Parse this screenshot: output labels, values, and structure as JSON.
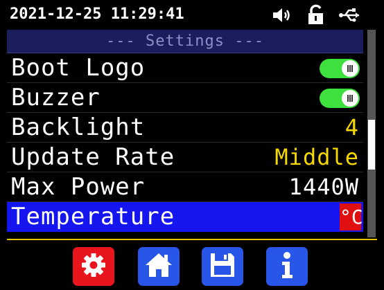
{
  "status": {
    "datetime": "2021-12-25 11:29:41",
    "icons": [
      "speaker-icon",
      "unlocked-icon",
      "usb-icon"
    ]
  },
  "header": {
    "title": "--- Settings ---"
  },
  "settings": [
    {
      "label": "Boot Logo",
      "type": "toggle",
      "state": "on"
    },
    {
      "label": "Buzzer",
      "type": "toggle",
      "state": "on"
    },
    {
      "label": "Backlight",
      "type": "value",
      "value": "4",
      "color": "#f5d800"
    },
    {
      "label": "Update Rate",
      "type": "value",
      "value": "Middle",
      "color": "#f5d800"
    },
    {
      "label": "Max Power",
      "type": "value",
      "value": "1440W",
      "color": "#ffffff"
    },
    {
      "label": "Temperature",
      "type": "badge",
      "value": "°C",
      "selected": true
    }
  ],
  "dock": [
    {
      "name": "settings",
      "icon": "gear-icon",
      "color": "#e8141e"
    },
    {
      "name": "home",
      "icon": "home-icon",
      "color": "#2856e8"
    },
    {
      "name": "save",
      "icon": "save-icon",
      "color": "#2856e8"
    },
    {
      "name": "info",
      "icon": "info-icon",
      "color": "#2856e8"
    }
  ],
  "colors": {
    "selection": "#1515f0",
    "toggle_on": "#3de03d",
    "divider": "#e5c400",
    "title_bg": "#1a1e5c"
  }
}
